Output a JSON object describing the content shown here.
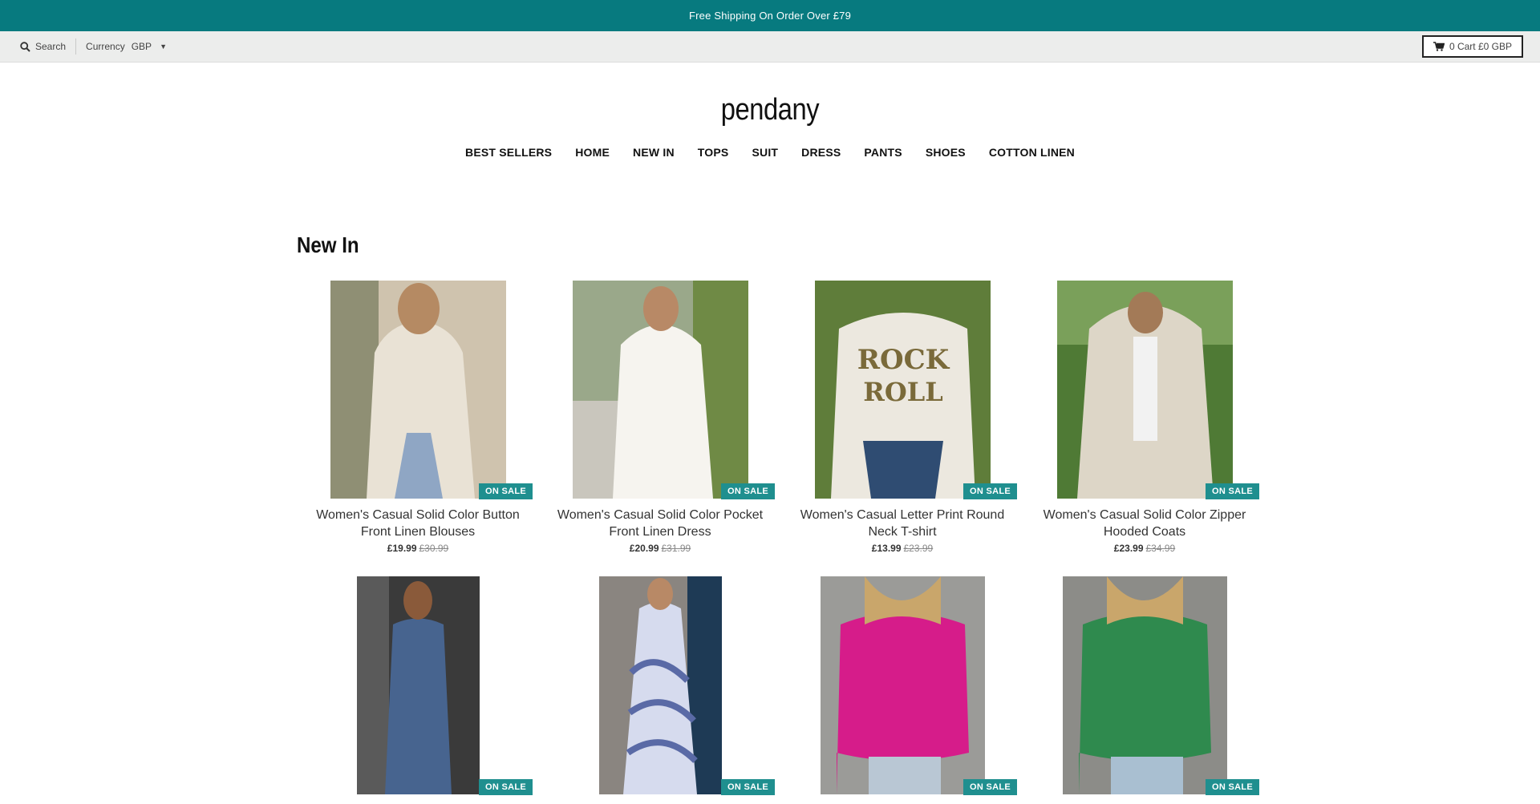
{
  "announcement": "Free Shipping On Order Over £79",
  "utility": {
    "search_label": "Search",
    "currency_label": "Currency",
    "currency_value": "GBP",
    "cart_label": "0 Cart £0 GBP"
  },
  "brand": "pendany",
  "nav": [
    "BEST SELLERS",
    "HOME",
    "NEW IN",
    "TOPS",
    "SUIT",
    "DRESS",
    "PANTS",
    "SHOES",
    "COTTON LINEN"
  ],
  "section_title": "New In",
  "badge_label": "ON SALE",
  "products": [
    {
      "title": "Women's Casual Solid Color Button Front Linen Blouses",
      "price": "£19.99",
      "was": "£30.99",
      "img_color": "#e6dfd2",
      "accent": "#cfc5b3"
    },
    {
      "title": "Women's Casual Solid Color Pocket Front Linen Dress",
      "price": "£20.99",
      "was": "£31.99",
      "img_color": "#f3f1ec",
      "accent": "#7b8a5a"
    },
    {
      "title": "Women's Casual Letter Print Round Neck T-shirt",
      "price": "£13.99",
      "was": "£23.99",
      "img_color": "#ece8df",
      "accent": "#3d5a7a"
    },
    {
      "title": "Women's Casual Solid Color Zipper Hooded Coats",
      "price": "£23.99",
      "was": "£34.99",
      "img_color": "#d9d3c5",
      "accent": "#5f7d3a"
    },
    {
      "title": "",
      "price": "",
      "was": "",
      "img_color": "#47648f",
      "accent": "#2f4668"
    },
    {
      "title": "",
      "price": "",
      "was": "",
      "img_color": "#c9cde0",
      "accent": "#5a6aa6"
    },
    {
      "title": "",
      "price": "",
      "was": "",
      "img_color": "#d61c8a",
      "accent": "#9a9a9a"
    },
    {
      "title": "",
      "price": "",
      "was": "",
      "img_color": "#2f8a4e",
      "accent": "#8f8f8f"
    }
  ]
}
